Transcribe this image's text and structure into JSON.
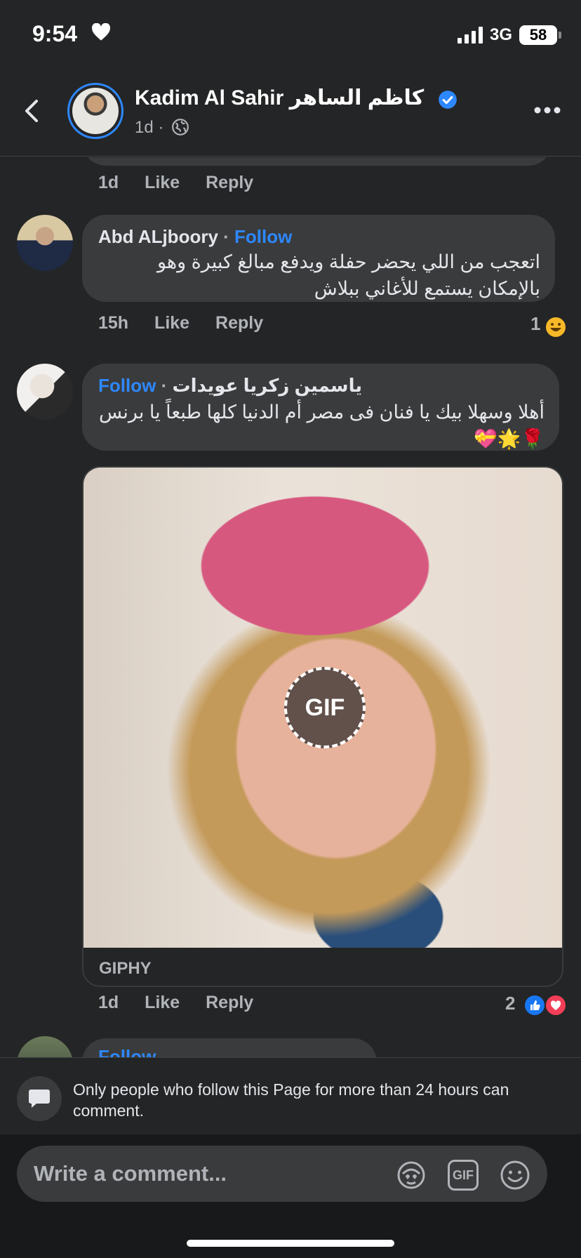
{
  "status_bar": {
    "time": "9:54",
    "network": "3G",
    "battery": "58"
  },
  "header": {
    "name": "Kadim Al Sahir كاظم الساهر",
    "time": "1d ·"
  },
  "previous_comment": {
    "time": "1d",
    "like": "Like",
    "reply": "Reply"
  },
  "comments": [
    {
      "author": "Abd ALjboory",
      "separator": "·",
      "follow": "Follow",
      "text": "اتعجب من اللي يحضر حفلة ويدفع مبالغ كبيرة وهو بالإمكان يستمع للأغاني ببلاش",
      "time": "15h",
      "like": "Like",
      "reply": "Reply",
      "reaction_count": "1"
    },
    {
      "author": "ياسمين زكريا عويدات",
      "separator": "·",
      "follow": "Follow",
      "text": "أهلا وسهلا بيك يا فنان فى مصر أم الدنيا كلها طبعاً يا برنس 🌹🌟💝",
      "gif_badge": "GIF",
      "gif_source": "GIPHY",
      "time": "1d",
      "like": "Like",
      "reply": "Reply",
      "reaction_count": "2"
    }
  ],
  "next_comment": {
    "follow": "Follow"
  },
  "notice": {
    "text": "Only people who follow this Page for more than 24 hours can comment."
  },
  "composer": {
    "placeholder": "Write a comment...",
    "gif_label": "GIF"
  },
  "colors": {
    "accent": "#2d88ff",
    "background": "#242526",
    "bubble": "#3a3b3c"
  }
}
